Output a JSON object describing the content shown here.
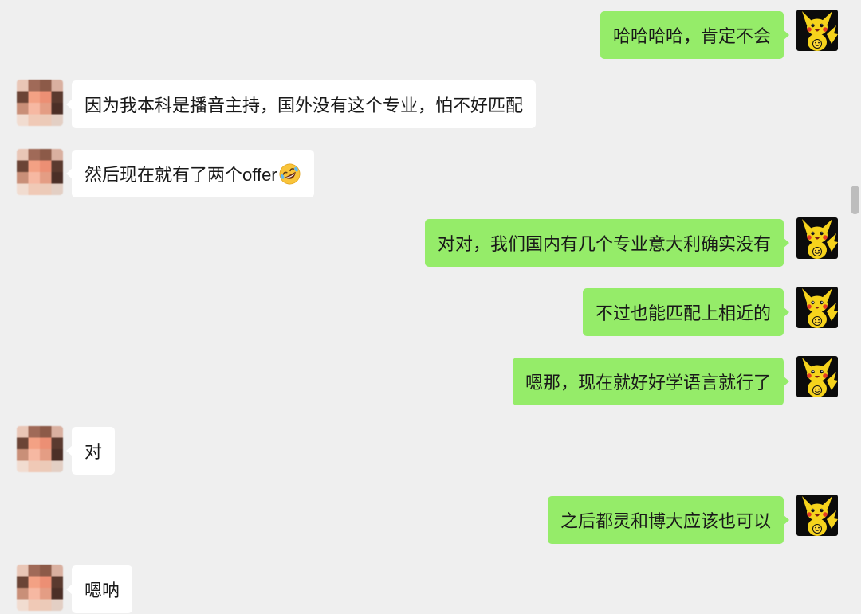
{
  "colors": {
    "background": "#efefef",
    "outgoing_bubble": "#95ec69",
    "incoming_bubble": "#ffffff",
    "text": "#191919",
    "scrollbar_thumb": "#bdbdbd"
  },
  "messages": [
    {
      "avatar_icon": "pikachu-avatar",
      "text": "哈哈哈哈，肯定不会"
    },
    {
      "avatar_icon": "pixelated-avatar",
      "text": "因为我本科是播音主持，国外没有这个专业，怕不好匹配"
    },
    {
      "avatar_icon": "pixelated-avatar",
      "text": "然后现在就有了两个offer",
      "emoji_icon": "rolling-on-the-floor-laughing-emoji-icon"
    },
    {
      "avatar_icon": "pikachu-avatar",
      "text": "对对，我们国内有几个专业意大利确实没有"
    },
    {
      "avatar_icon": "pikachu-avatar",
      "text": "不过也能匹配上相近的"
    },
    {
      "avatar_icon": "pikachu-avatar",
      "text": "嗯那，现在就好好学语言就行了"
    },
    {
      "avatar_icon": "pixelated-avatar",
      "text": "对"
    },
    {
      "avatar_icon": "pikachu-avatar",
      "text": "之后都灵和博大应该也可以"
    },
    {
      "avatar_icon": "pixelated-avatar",
      "text": "嗯呐"
    }
  ]
}
